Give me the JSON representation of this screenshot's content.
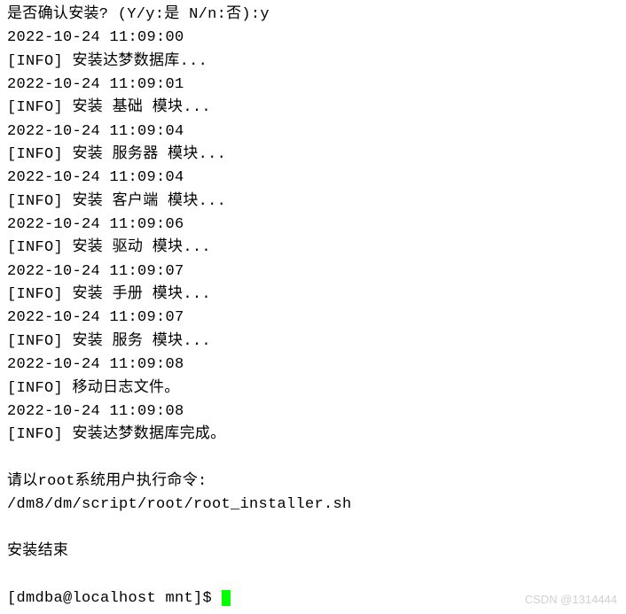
{
  "terminal": {
    "lines": [
      "是否确认安装? (Y/y:是 N/n:否):y",
      "2022-10-24 11:09:00",
      "[INFO] 安装达梦数据库...",
      "2022-10-24 11:09:01",
      "[INFO] 安装 基础 模块...",
      "2022-10-24 11:09:04",
      "[INFO] 安装 服务器 模块...",
      "2022-10-24 11:09:04",
      "[INFO] 安装 客户端 模块...",
      "2022-10-24 11:09:06",
      "[INFO] 安装 驱动 模块...",
      "2022-10-24 11:09:07",
      "[INFO] 安装 手册 模块...",
      "2022-10-24 11:09:07",
      "[INFO] 安装 服务 模块...",
      "2022-10-24 11:09:08",
      "[INFO] 移动日志文件。",
      "2022-10-24 11:09:08",
      "[INFO] 安装达梦数据库完成。",
      "",
      "请以root系统用户执行命令:",
      "/dm8/dm/script/root/root_installer.sh",
      "",
      "安装结束",
      ""
    ],
    "prompt": "[dmdba@localhost mnt]$ "
  },
  "watermark": "CSDN @1314444"
}
